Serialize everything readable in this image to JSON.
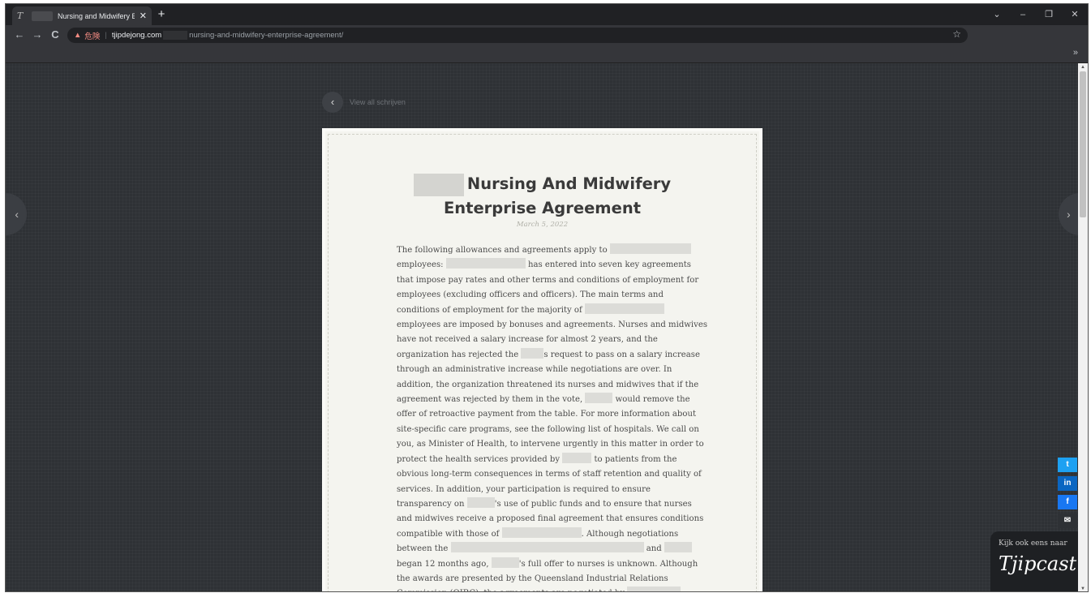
{
  "browser": {
    "tab_title": "Nursing and Midwifery Ent",
    "favicon": "T",
    "close": "✕",
    "new_tab": "+",
    "controls": {
      "chevron": "⌄",
      "minimize": "–",
      "restore": "❐",
      "close": "✕"
    },
    "nav": {
      "back": "←",
      "forward": "→",
      "reload": "C"
    },
    "address": {
      "warning_icon": "▲",
      "warning_text": "危険",
      "separator": "|",
      "host": "tjipdejong.com",
      "path": "nursing-and-midwifery-enterprise-agreement/"
    },
    "bookmark_star": "☆",
    "bookmarks_more": "»"
  },
  "page": {
    "back_link_icon": "‹",
    "back_link": "View all schrijven",
    "prev_arrow": "‹",
    "next_arrow": "›",
    "title_line1": "Nursing And Midwifery",
    "title_line2": "Enterprise Agreement",
    "date": "March 5, 2022",
    "body": [
      [
        "The following allowances and agreements apply to ",
        {
          "r": 100
        }
      ],
      [
        "employees: ",
        {
          "r": 98
        },
        " has entered into seven key agreements"
      ],
      [
        "that impose pay rates and other terms and conditions of employment for"
      ],
      [
        "employees (excluding officers and officers). The main terms and"
      ],
      [
        "conditions of employment for the majority of ",
        {
          "r": 98
        }
      ],
      [
        "employees are imposed by bonuses and agreements. Nurses and midwives"
      ],
      [
        "have not received a salary increase for almost 2 years, and the"
      ],
      [
        "organization has rejected the ",
        {
          "r": 28
        },
        "s request to pass on a salary increase"
      ],
      [
        "through an administrative increase while negotiations are over. In"
      ],
      [
        "addition, the organization threatened its nurses and midwives that if the"
      ],
      [
        "agreement was rejected by them in the vote, ",
        {
          "r": 34
        },
        " would remove the"
      ],
      [
        "offer of retroactive payment from the table. For more information about"
      ],
      [
        "site-specific care programs, see the following list of hospitals. We call on"
      ],
      [
        "you, as Minister of Health, to intervene urgently in this matter in order to"
      ],
      [
        "protect the health services provided by ",
        {
          "r": 36
        },
        " to patients from the"
      ],
      [
        "obvious long-term consequences in terms of staff retention and quality of"
      ],
      [
        "services. In addition, your participation is required to ensure"
      ],
      [
        "transparency on ",
        {
          "r": 34
        },
        "'s use of public funds and to ensure that nurses"
      ],
      [
        "and midwives receive a proposed final agreement that ensures conditions"
      ],
      [
        "compatible with those of ",
        {
          "r": 98
        },
        ". Although negotiations"
      ],
      [
        "between the ",
        {
          "r": 238
        },
        " and ",
        {
          "r": 34
        }
      ],
      [
        "began 12 months ago, ",
        {
          "r": 34
        },
        "'s full offer to nurses is unknown. Although"
      ],
      [
        "the awards are presented by the Queensland Industrial Relations"
      ],
      [
        "Commission (QIRC), the agreements are negotiated by ",
        {
          "r": 66
        }
      ]
    ],
    "share": {
      "twitter": "t",
      "linkedin": "in",
      "facebook": "f",
      "email": "✉"
    },
    "promo_label": "Kijk ook eens naar",
    "promo_logo": "Tjipcast"
  }
}
